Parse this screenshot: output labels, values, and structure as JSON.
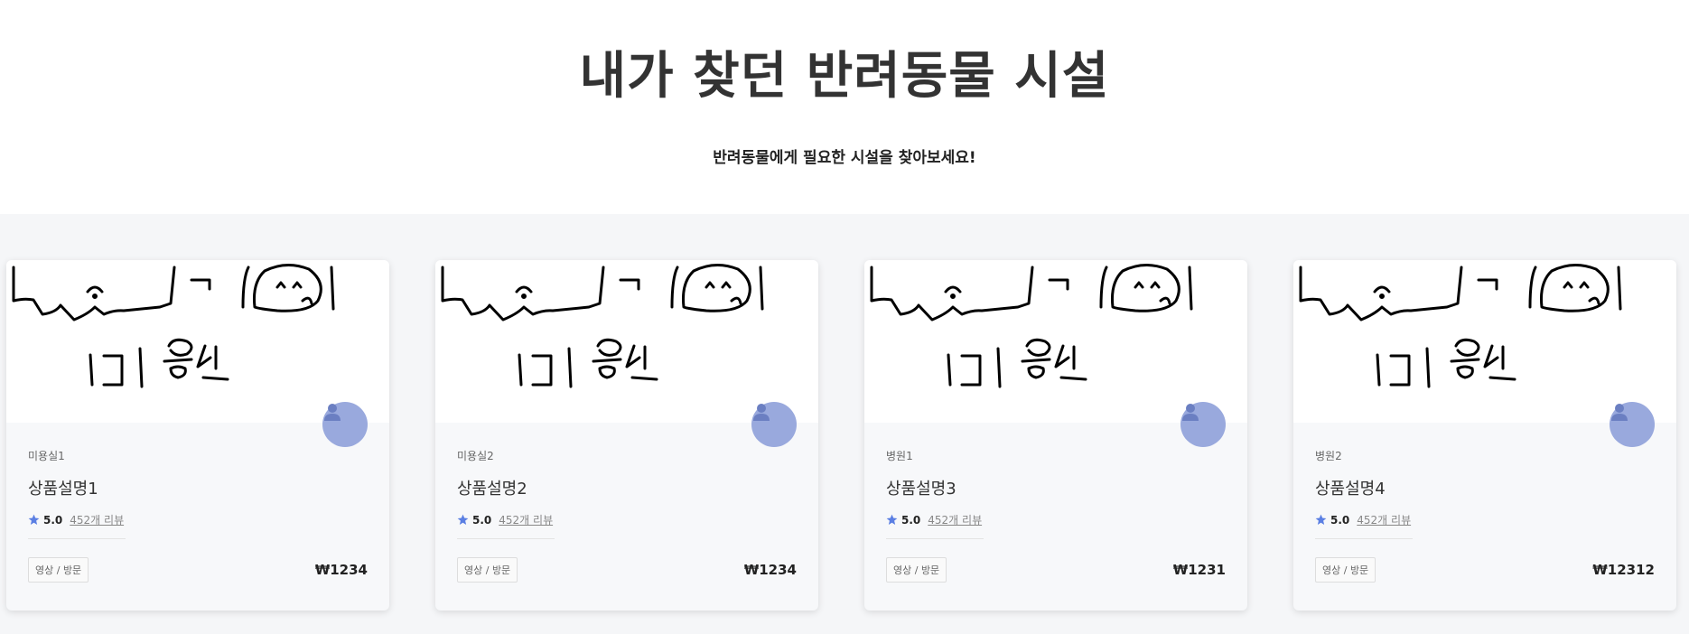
{
  "hero": {
    "title": "내가 찾던 반려동물 시설",
    "subtitle": "반려동물에게 필요한 시설을 찾아보세요!"
  },
  "colors": {
    "avatar_bg": "#99a9dd",
    "star": "#5b7fe3",
    "section_bg": "#f5f6f8"
  },
  "cards": [
    {
      "category": "미용실1",
      "title": "상품설명1",
      "rating": "5.0",
      "reviews": "452개 리뷰",
      "tag": "영상 / 방문",
      "price": "₩1234",
      "image_text": "미용실"
    },
    {
      "category": "미용실2",
      "title": "상품설명2",
      "rating": "5.0",
      "reviews": "452개 리뷰",
      "tag": "영상 / 방문",
      "price": "₩1234",
      "image_text": "미용실"
    },
    {
      "category": "병원1",
      "title": "상품설명3",
      "rating": "5.0",
      "reviews": "452개 리뷰",
      "tag": "영상 / 방문",
      "price": "₩1231",
      "image_text": "미용실"
    },
    {
      "category": "병원2",
      "title": "상품설명4",
      "rating": "5.0",
      "reviews": "452개 리뷰",
      "tag": "영상 / 방문",
      "price": "₩12312",
      "image_text": "미용실"
    }
  ]
}
